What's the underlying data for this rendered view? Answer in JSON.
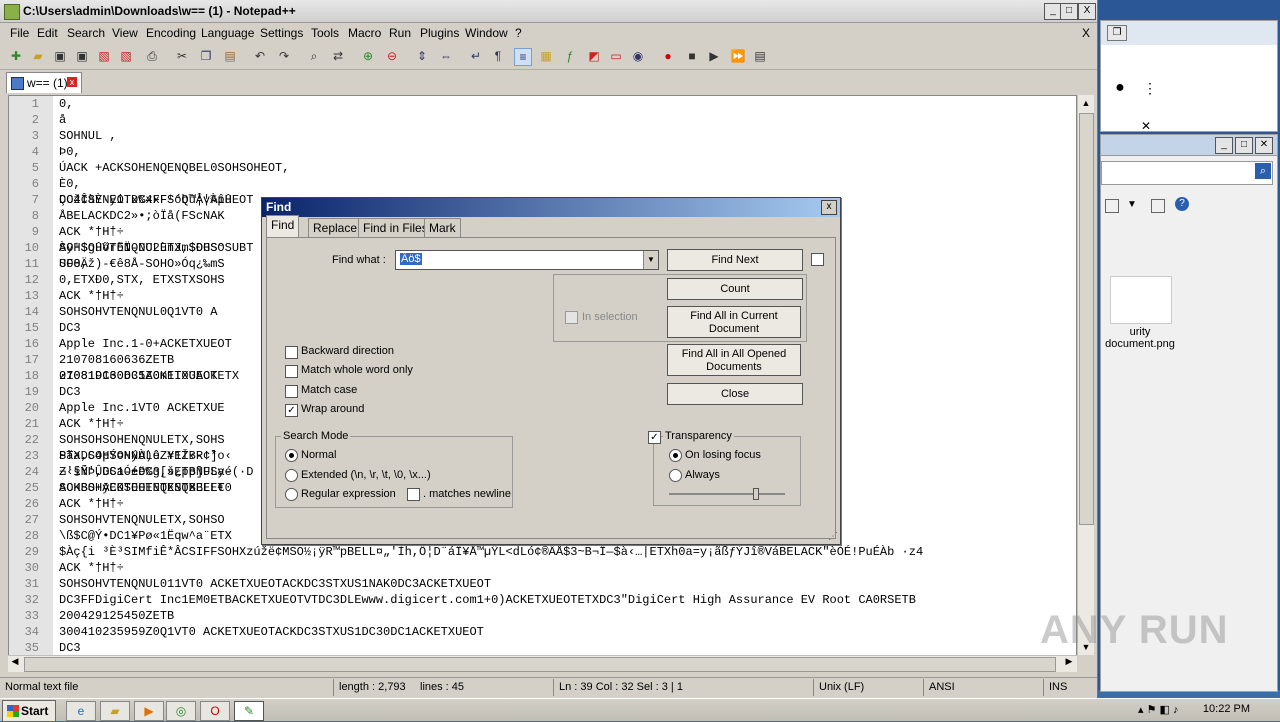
{
  "window": {
    "title": "C:\\Users\\admin\\Downloads\\w== (1) - Notepad++",
    "minimize": "_",
    "maximize": "□",
    "close": "X"
  },
  "menu": [
    "File",
    "Edit",
    "Search",
    "View",
    "Encoding",
    "Language",
    "Settings",
    "Tools",
    "Macro",
    "Run",
    "Plugins",
    "Window",
    "?"
  ],
  "menu_close": "X",
  "toolbar_icons": [
    "new-icon",
    "open-icon",
    "save-icon",
    "save-all-icon",
    "close-icon",
    "close-all-icon",
    "print-icon",
    "cut-icon",
    "copy-icon",
    "paste-icon",
    "undo-icon",
    "redo-icon",
    "find-icon",
    "replace-icon",
    "zoom-in-icon",
    "zoom-out-icon",
    "sync-v-icon",
    "sync-h-icon",
    "wrap-icon",
    "show-all-icon",
    "indent-guide-icon",
    "doc-map-icon",
    "function-list-icon",
    "folder-icon",
    "monitor-icon",
    "record-icon",
    "stop-icon",
    "play-icon",
    "play-multi-icon",
    "save-macro-icon"
  ],
  "tab": {
    "label": "w== (1)",
    "close": "x"
  },
  "editor_lines": [
    {
      "n": "1",
      "t": "0,"
    },
    {
      "n": "2",
      "t": "å"
    },
    {
      "n": "3",
      "t": "SOHNUL ,"
    },
    {
      "n": "4",
      "t": "Þ0,"
    },
    {
      "n": "5",
      "t": "ÚACK    +ACKSOHENQENQBEL0SOHSOHEOT,"
    },
    {
      "n": "6",
      "t": "È0,"
    },
    {
      "n": "7",
      "t": "ÇOž¢SYNEOTDC4FF¹óbü¦¦¾îH"
    },
    {
      "n": "8",
      "t": "ÅBELACKDC2»•;òÏå(FScNAK"
    },
    {
      "n": "9",
      "t": "ACK *†H†÷"
    },
    {
      "n": "10",
      "t": "SOHSOHVTENQNULETX,SOHSO"
    },
    {
      "n": "11",
      "t": "UF8Äž)-€ê8Å-SOHO»Óq¿‰mS"
    },
    {
      "n": "12",
      "t": "0,ETXÐ0,STX, ETXSTXSOHS"
    },
    {
      "n": "13",
      "t": "ACK *†H†÷"
    },
    {
      "n": "14",
      "t": "SOHSOHVTENQNUL0Q1VT0  A"
    },
    {
      "n": "15",
      "t": "DC3"
    },
    {
      "n": "16",
      "t": "Apple Inc.1-0+ACKETXUEOT"
    },
    {
      "n": "17",
      "t": "210708160636ZETB"
    },
    {
      "n": "18",
      "t": "210819160635Z0m1I0GACKETX"
    },
    {
      "n": "19",
      "t": "DC3"
    },
    {
      "n": "20",
      "t": "Apple Inc.1VT0  ACKETXUE"
    },
    {
      "n": "21",
      "t": "ACK *†H†÷"
    },
    {
      "n": "22",
      "t": "SOHSOHSOHENQNULETX,SOHS"
    },
    {
      "n": "23",
      "t": "STX,SOHSOHNULêZ#ETB-!*o‹"
    },
    {
      "n": "24",
      "t": "Z'§Ý'ÛDC1-éë%g[šETBNULyé"
    },
    {
      "n": "25",
      "t": "ACKBS+ACKSOHENQENQBELET"
    },
    {
      "n": "26",
      "t": "ACK *†H†÷"
    },
    {
      "n": "27",
      "t": "SOHSOHVTENQNULETX,SOHSO"
    },
    {
      "n": "28",
      "t": "\\ß$C@Ý•DC1¥Pø«1Ëqw^a¨ETX"
    },
    {
      "n": "29",
      "t": "    $Àç{i ³È³SIMfiÊ*ÂCSIFFSOHXzúžë¢MSO½¡ÿR™pBELL¤„'Ìh,Ö¦D¨áÏ¥Å™µŸL<dLó¢®ÄÅ$3~B¬Ï—$à‹…|ETXh0a=y¡ãßƒÝJî®VáBELACK\"èÒÉ!PuÉÀb ·z4"
    },
    {
      "n": "30",
      "t": "ACK *†H†÷"
    },
    {
      "n": "31",
      "t": "SOHSOHVTENQNUL011VT0  ACKETXUEOTACKDC3STXUS1NAK0DC3ACKETXUEOT"
    },
    {
      "n": "32",
      "t": "DC3FFDigiCert Inc1EM0ETBACKETXUEOTVTDC3DLEwww.digicert.com1+0)ACKETXUEOTETXDC3\"DigiCert High Assurance EV Root CA0RSETB"
    },
    {
      "n": "33",
      "t": "200429125450ZETB"
    },
    {
      "n": "34",
      "t": "300410235959Z0Q1VT0  ACKETXUEOTACKDC3STXUS1DC30DC1ACKETXUEOT"
    },
    {
      "n": "35",
      "t": "DC3"
    }
  ],
  "editor_right_fragments": [
    {
      "line": "7",
      "t": "DC4ÎàÈ·ÿi.x%xxFS°Q™ÂvÀpûEOT"
    },
    {
      "line": "10",
      "t": "Àÿ¹$gûõrõÏ-DC2ùnJm$ÐGS°SUBT"
    },
    {
      "line": "11",
      "t": "SO0,"
    },
    {
      "line": "18",
      "t": "07081DC30DC1ACKETXUEOT"
    },
    {
      "line": "23",
      "t": "PãaDC4pÝ¤NýÀ)ü Y1Ž‹R¢]"
    },
    {
      "line": "24",
      "t": "¬‹íÑÞ,GSaÓ±DC3,»¿pp]FSa-(·D"
    },
    {
      "line": "25",
      "t": "SOHSOHÿEOTEOTETXSTXBEL€0"
    }
  ],
  "statusbar": {
    "type": "Normal text file",
    "length": "length : 2,793",
    "lines": "lines : 45",
    "pos": "Ln : 39    Col : 32    Sel : 3 | 1",
    "eol": "Unix (LF)",
    "encoding": "ANSI",
    "mode": "INS"
  },
  "find_dialog": {
    "title": "Find",
    "close": "x",
    "tabs": [
      "Find",
      "Replace",
      "Find in Files",
      "Mark"
    ],
    "find_what_label": "Find what :",
    "find_what_value": "Äö$",
    "in_selection": "In selection",
    "buttons": {
      "find_next": "Find Next",
      "count": "Count",
      "find_all_current": "Find All in Current Document",
      "find_all_opened": "Find All in All Opened Documents",
      "close": "Close"
    },
    "options": [
      {
        "label": "Backward direction",
        "checked": false
      },
      {
        "label": "Match whole word only",
        "checked": false
      },
      {
        "label": "Match case",
        "checked": false
      },
      {
        "label": "Wrap around",
        "checked": true
      }
    ],
    "search_mode": {
      "title": "Search Mode",
      "normal": "Normal",
      "extended": "Extended (\\n, \\r, \\t, \\0, \\x...)",
      "regex": "Regular expression",
      "matches_newline": ". matches newline",
      "selected": "normal"
    },
    "transparency": {
      "label": "Transparency",
      "checked": true,
      "on_losing_focus": "On losing focus",
      "always": "Always",
      "selected": "on_losing_focus",
      "level": 0.75
    }
  },
  "background_window": {
    "file_label": "urity document.png"
  },
  "taskbar": {
    "start": "Start",
    "apps": [
      "ie-icon",
      "explorer-icon",
      "media-player-icon",
      "chrome-icon",
      "opera-icon",
      "notepadpp-icon"
    ],
    "clock": "10:22 PM"
  },
  "watermark": "ANY RUN"
}
